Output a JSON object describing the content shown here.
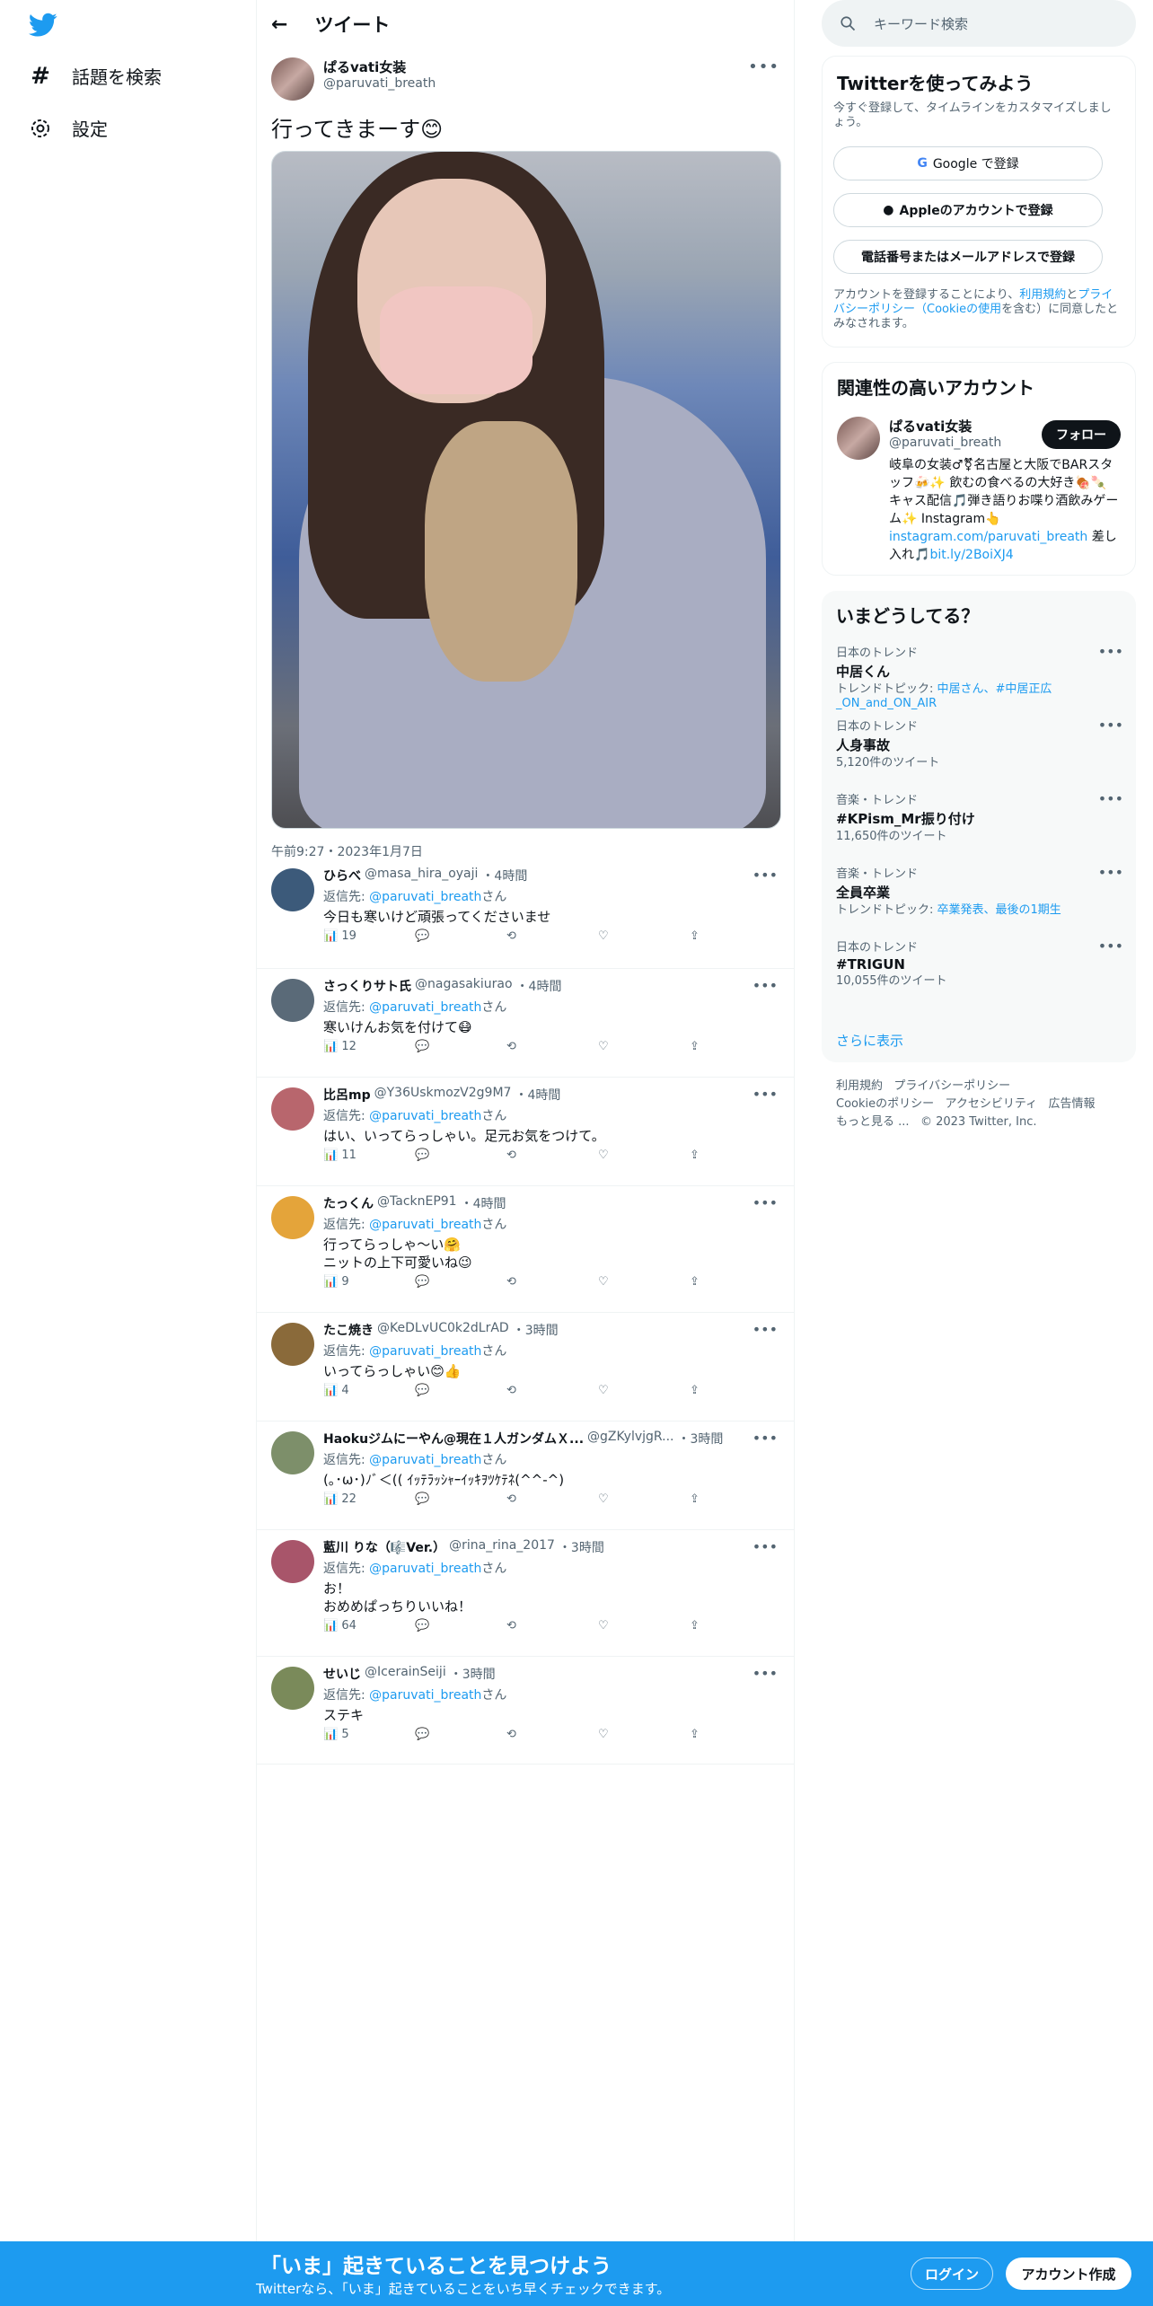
{
  "nav": {
    "explore": "話題を検索",
    "settings": "設定"
  },
  "header": {
    "title": "ツイート"
  },
  "tweet": {
    "name": "ぱるvati女装",
    "handle": "@paruvati_breath",
    "text": "行ってきまーす😊",
    "meta": "午前9:27・2023年1月7日"
  },
  "replies": [
    {
      "name": "ひらべ",
      "handle": "@masa_hira_oyaji",
      "time": "・4時間",
      "replyto": "返信先: ",
      "mention": "@paruvati_breath",
      "suffix": "さん",
      "text": "今日も寒いけど頑張ってくださいませ",
      "views": "19",
      "avatar": "#3c5a7a"
    },
    {
      "name": "さっくりサト氏",
      "handle": "@nagasakiurao",
      "time": "・4時間",
      "replyto": "返信先: ",
      "mention": "@paruvati_breath",
      "suffix": "さん",
      "text": "寒いけんお気を付けて😷",
      "views": "12",
      "avatar": "#5a6a78"
    },
    {
      "name": "比呂mp",
      "handle": "@Y36UskmozV2g9M7",
      "time": "・4時間",
      "replyto": "返信先: ",
      "mention": "@paruvati_breath",
      "suffix": "さん",
      "text": "はい、いってらっしゃい。足元お気をつけて。",
      "views": "11",
      "avatar": "#b8666d"
    },
    {
      "name": "たっくん",
      "handle": "@TacknEP91",
      "time": "・4時間",
      "replyto": "返信先: ",
      "mention": "@paruvati_breath",
      "suffix": "さん",
      "text": "行ってらっしゃ〜い🤗\nニットの上下可愛いね😉",
      "views": "9",
      "avatar": "#e4a43a"
    },
    {
      "name": "たこ焼き",
      "handle": "@KeDLvUC0k2dLrAD",
      "time": "・3時間",
      "replyto": "返信先: ",
      "mention": "@paruvati_breath",
      "suffix": "さん",
      "text": "いってらっしゃい😊👍",
      "views": "4",
      "avatar": "#8a6a3a"
    },
    {
      "name": "Haokuジムにーやん@現在１人ガンダムＸ...",
      "handle": "@gZKylvjgR...",
      "time": "・3時間",
      "replyto": "返信先: ",
      "mention": "@paruvati_breath",
      "suffix": "さん",
      "text": "(｡･ω･)ﾉﾞ＜(( ｲｯﾃﾗｯｼｬｰｲｯｷｦﾂｹﾃﾈ(^^-^)",
      "views": "22",
      "avatar": "#7d8f6a"
    },
    {
      "name": "藍川 りな（🎼Ver.）",
      "handle": "@rina_rina_2017",
      "time": "・3時間",
      "replyto": "返信先: ",
      "mention": "@paruvati_breath",
      "suffix": "さん",
      "text": "お！\nおめめぱっちりいいね！",
      "views": "64",
      "avatar": "#a8556a"
    },
    {
      "name": "せいじ",
      "handle": "@IcerainSeiji",
      "time": "・3時間",
      "replyto": "返信先: ",
      "mention": "@paruvati_breath",
      "suffix": "さん",
      "text": "ステキ",
      "views": "5",
      "avatar": "#7a8a5a"
    }
  ],
  "search": {
    "placeholder": "キーワード検索"
  },
  "signup": {
    "title": "Twitterを使ってみよう",
    "subtitle": "今すぐ登録して、タイムラインをカスタマイズしましょう。",
    "google": "Google で登録",
    "apple": "Appleのアカウントで登録",
    "phone": "電話番号またはメールアドレスで登録",
    "terms_pre": "アカウントを登録することにより、",
    "terms_link1": "利用規約",
    "terms_and": "と",
    "terms_link2": "プライバシーポリシー（Cookieの使用",
    "terms_post": "を含む）に同意したとみなされます。"
  },
  "related": {
    "title": "関連性の高いアカウント",
    "name": "ぱるvati女装",
    "handle": "@paruvati_breath",
    "follow": "フォロー",
    "bio": "岐阜の女装♂⚧名古屋と大阪でBARスタッフ🍻✨ 飲むの食べるの大好き🍖🍡 キャス配信🎵弾き語りお喋り酒飲みゲーム✨ Instagram👆",
    "bio_link": "instagram.com/paruvati_breath",
    "bio_tail": " 差し入れ🎵",
    "bio_link2": "bit.ly/2BoiXJ4"
  },
  "trends": {
    "title": "いまどうしてる？",
    "items": [
      {
        "cat": "日本のトレンド",
        "name": "中居くん",
        "count_pre": "トレンドトピック: ",
        "count_link": "中居さん、#中居正広_ON_and_ON_AIR",
        "count": ""
      },
      {
        "cat": "日本のトレンド",
        "name": "人身事故",
        "count_pre": "",
        "count_link": "",
        "count": "5,120件のツイート"
      },
      {
        "cat": "音楽・トレンド",
        "name": "#KPism_Mr振り付け",
        "count_pre": "",
        "count_link": "",
        "count": "11,650件のツイート"
      },
      {
        "cat": "音楽・トレンド",
        "name": "全員卒業",
        "count_pre": "トレンドトピック: ",
        "count_link": "卒業発表、最後の1期生",
        "count": ""
      },
      {
        "cat": "日本のトレンド",
        "name": "#TRIGUN",
        "count_pre": "",
        "count_link": "",
        "count": "10,055件のツイート"
      }
    ],
    "more": "さらに表示"
  },
  "footer": {
    "l1": "利用規約",
    "l2": "プライバシーポリシー",
    "l3": "Cookieのポリシー",
    "l4": "アクセシビリティ",
    "l5": "広告情報",
    "l6": "もっと見る ...",
    "copy": "© 2023 Twitter, Inc."
  },
  "bottom": {
    "title": "「いま」起きていることを見つけよう",
    "sub": "Twitterなら、「いま」起きていることをいち早くチェックできます。",
    "login": "ログイン",
    "signup": "アカウント作成"
  },
  "colors": {
    "accent": "#1d9bf0",
    "text": "#0f1419",
    "muted": "#536471"
  }
}
